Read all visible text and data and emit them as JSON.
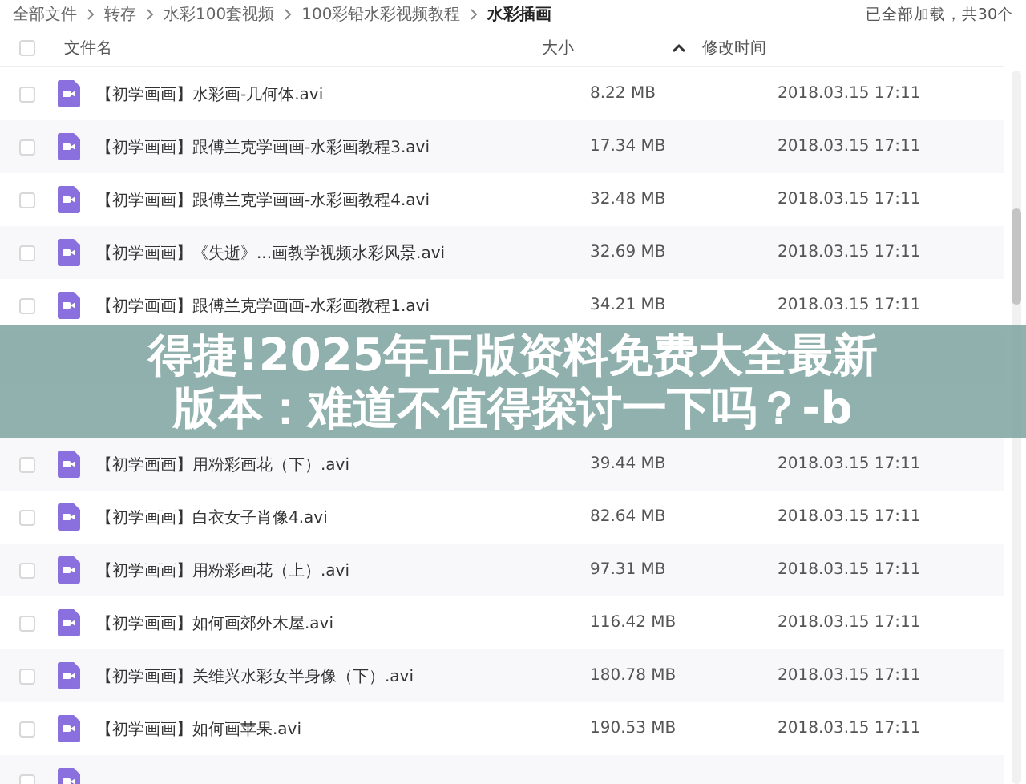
{
  "breadcrumb": [
    "全部文件",
    "转存",
    "水彩100套视频",
    "100彩铅水彩视频教程",
    "水彩插画"
  ],
  "load_status": "已全部加载，共30个",
  "select_all": {
    "checked": false
  },
  "columns": [
    {
      "label": "文件名"
    },
    {
      "label": "大小",
      "sorted": true
    },
    {
      "label": "修改时间"
    }
  ],
  "rows": [
    {
      "kind": "file",
      "name": "【初学画画】水彩画-几何体.avi",
      "size": "8.22 MB",
      "modified": "2018.03.15 17:11",
      "checked": false
    },
    {
      "kind": "file",
      "name": "【初学画画】跟傅兰克学画画-水彩画教程3.avi",
      "size": "17.34 MB",
      "modified": "2018.03.15 17:11",
      "checked": false
    },
    {
      "kind": "file",
      "name": "【初学画画】跟傅兰克学画画-水彩画教程4.avi",
      "size": "32.48 MB",
      "modified": "2018.03.15 17:11",
      "checked": false
    },
    {
      "kind": "file",
      "name": "【初学画画】《失逝》...画教学视频水彩风景.avi",
      "size": "32.69 MB",
      "modified": "2018.03.15 17:11",
      "checked": false
    },
    {
      "kind": "file",
      "name": "【初学画画】跟傅兰克学画画-水彩画教程1.avi",
      "size": "34.21 MB",
      "modified": "2018.03.15 17:11",
      "checked": false
    },
    {
      "kind": "obscured"
    },
    {
      "kind": "obscured"
    },
    {
      "kind": "file",
      "name": "【初学画画】用粉彩画花（下）.avi",
      "size": "39.44 MB",
      "modified": "2018.03.15 17:11",
      "checked": false
    },
    {
      "kind": "file",
      "name": "【初学画画】白衣女子肖像4.avi",
      "size": "82.64 MB",
      "modified": "2018.03.15 17:11",
      "checked": false
    },
    {
      "kind": "file",
      "name": "【初学画画】用粉彩画花（上）.avi",
      "size": "97.31 MB",
      "modified": "2018.03.15 17:11",
      "checked": false
    },
    {
      "kind": "file",
      "name": "【初学画画】如何画郊外木屋.avi",
      "size": "116.42 MB",
      "modified": "2018.03.15 17:11",
      "checked": false
    },
    {
      "kind": "file",
      "name": "【初学画画】关维兴水彩女半身像（下）.avi",
      "size": "180.78 MB",
      "modified": "2018.03.15 17:11",
      "checked": false
    },
    {
      "kind": "file",
      "name": "【初学画画】如何画苹果.avi",
      "size": "190.53 MB",
      "modified": "2018.03.15 17:11",
      "checked": false
    },
    {
      "kind": "partial",
      "checked": false
    }
  ],
  "banner": {
    "lines": [
      "得捷!2025年正版资料免费大全最新",
      "版本：难道不值得探讨一下吗？-b"
    ]
  }
}
